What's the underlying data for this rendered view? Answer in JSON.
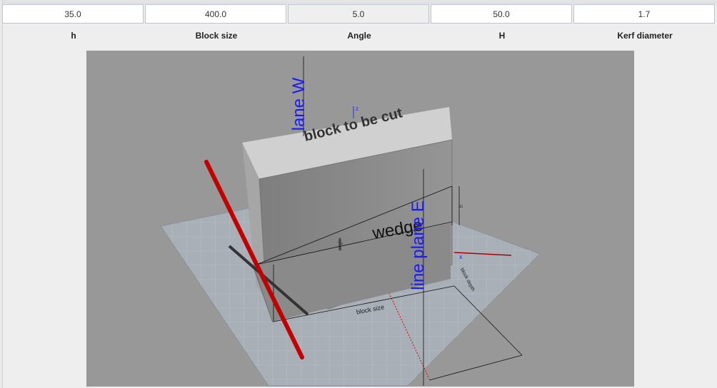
{
  "fields": [
    {
      "name": "h-field",
      "value": "35.0",
      "label": "h"
    },
    {
      "name": "block-size-field",
      "value": "400.0",
      "label": "Block size"
    },
    {
      "name": "angle-field",
      "value": "5.0",
      "label": "Angle"
    },
    {
      "name": "H-field",
      "value": "50.0",
      "label": "H"
    },
    {
      "name": "kerf-diameter-field",
      "value": "1.7",
      "label": "Kerf diameter"
    }
  ],
  "scene": {
    "block_label": "block to be cut",
    "wedge_label": "wedge",
    "plane_w_label": "lane W",
    "plane_e_label": "line plane E",
    "dim_block_size": "block size",
    "dim_angle": "angle",
    "dim_h": "h",
    "dim_depth": "block depth",
    "axis_z": "z",
    "axis_x": "x"
  },
  "colors": {
    "viewport_bg": "#989898",
    "grid": "#a7aeb6",
    "block_front": "#8d8d8d",
    "block_top": "#d6d6d6",
    "block_side": "#9e9e9e",
    "kerf_wire": "#d10000",
    "plane_labels": "#1a1aff"
  }
}
